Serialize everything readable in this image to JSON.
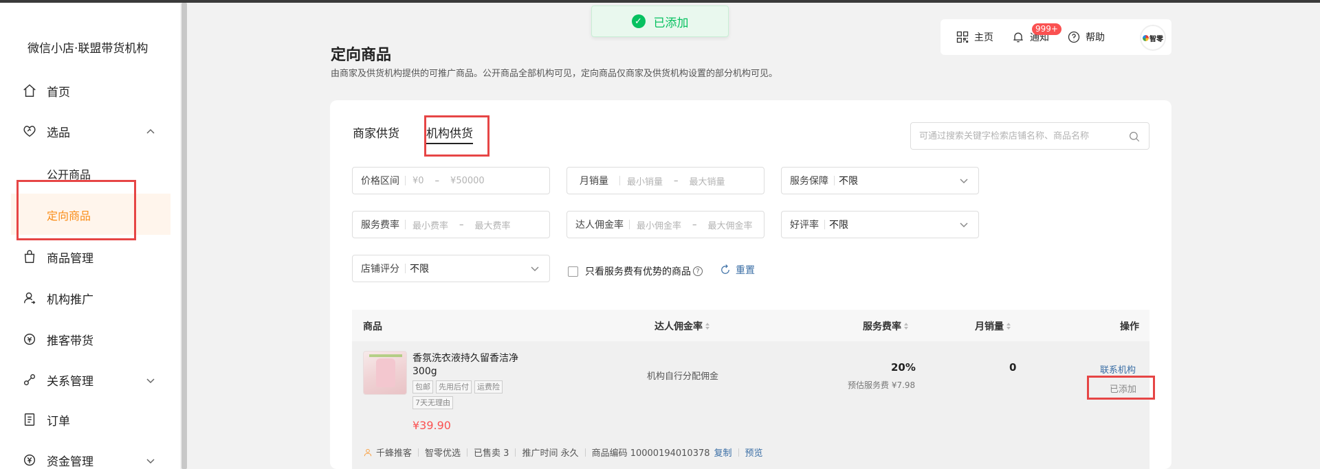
{
  "sidebar": {
    "brand": "微信小店·联盟带货机构",
    "items": [
      {
        "label": "首页",
        "icon": "home-icon"
      },
      {
        "label": "选品",
        "icon": "heart-tag-icon",
        "expanded": true
      },
      {
        "label": "商品管理",
        "icon": "bag-icon"
      },
      {
        "label": "机构推广",
        "icon": "user-promo-icon"
      },
      {
        "label": "推客带货",
        "icon": "coin-icon"
      },
      {
        "label": "关系管理",
        "icon": "relation-icon"
      },
      {
        "label": "订单",
        "icon": "order-icon"
      },
      {
        "label": "资金管理",
        "icon": "yen-icon"
      }
    ],
    "sub_items": [
      "公开商品",
      "定向商品"
    ]
  },
  "toast": {
    "text": "已添加",
    "color": "#07c160"
  },
  "topbar": {
    "home": "主页",
    "notify": "通知",
    "notify_badge": "999+",
    "help": "帮助",
    "avatar_text": "智零"
  },
  "page": {
    "title": "定向商品",
    "desc": "由商家及供货机构提供的可推广商品。公开商品全部机构可见，定向商品仅商家及供货机构设置的部分机构可见。"
  },
  "tabs": [
    "商家供货",
    "机构供货"
  ],
  "search": {
    "placeholder": "可通过搜索关键字检索店铺名称、商品名称"
  },
  "filters": {
    "price": {
      "label": "价格区间",
      "min": "¥0",
      "max": "¥50000"
    },
    "sales": {
      "label": "月销量",
      "min": "最小销量",
      "max": "最大销量"
    },
    "guarantee": {
      "label": "服务保障",
      "value": "不限"
    },
    "fee": {
      "label": "服务费率",
      "min": "最小费率",
      "max": "最大费率"
    },
    "commission": {
      "label": "达人佣金率",
      "min": "最小佣金率",
      "max": "最大佣金率"
    },
    "rating": {
      "label": "好评率",
      "value": "不限"
    },
    "store": {
      "label": "店铺评分",
      "value": "不限"
    },
    "advantage_only": "只看服务费有优势的商品",
    "help_mark": "?",
    "reset": "重置"
  },
  "table": {
    "headers": [
      "商品",
      "达人佣金率",
      "服务费率",
      "月销量",
      "操作"
    ],
    "rows": [
      {
        "name": "香氛洗衣液持久留香洁净300g",
        "tags": [
          "包邮",
          "先用后付",
          "运费险",
          "7天无理由"
        ],
        "price": "¥39.90",
        "commission": "机构自行分配佣金",
        "fee_rate": "20%",
        "fee_est": "预估服务费 ¥7.98",
        "monthly_sales": "0",
        "op_contact": "联系机构",
        "op_added": "已添加",
        "meta": {
          "promoter": "千蜂推客",
          "shop": "智零优选",
          "sold": "已售卖 3",
          "period": "推广时间 永久",
          "code": "商品编码 10000194010378",
          "copy": "复制",
          "preview": "预览"
        }
      }
    ]
  },
  "colors": {
    "accent_orange": "#fa8c16",
    "link_blue": "#3a6ea5",
    "price_red": "#fa5151",
    "highlight_red": "#e64545"
  }
}
